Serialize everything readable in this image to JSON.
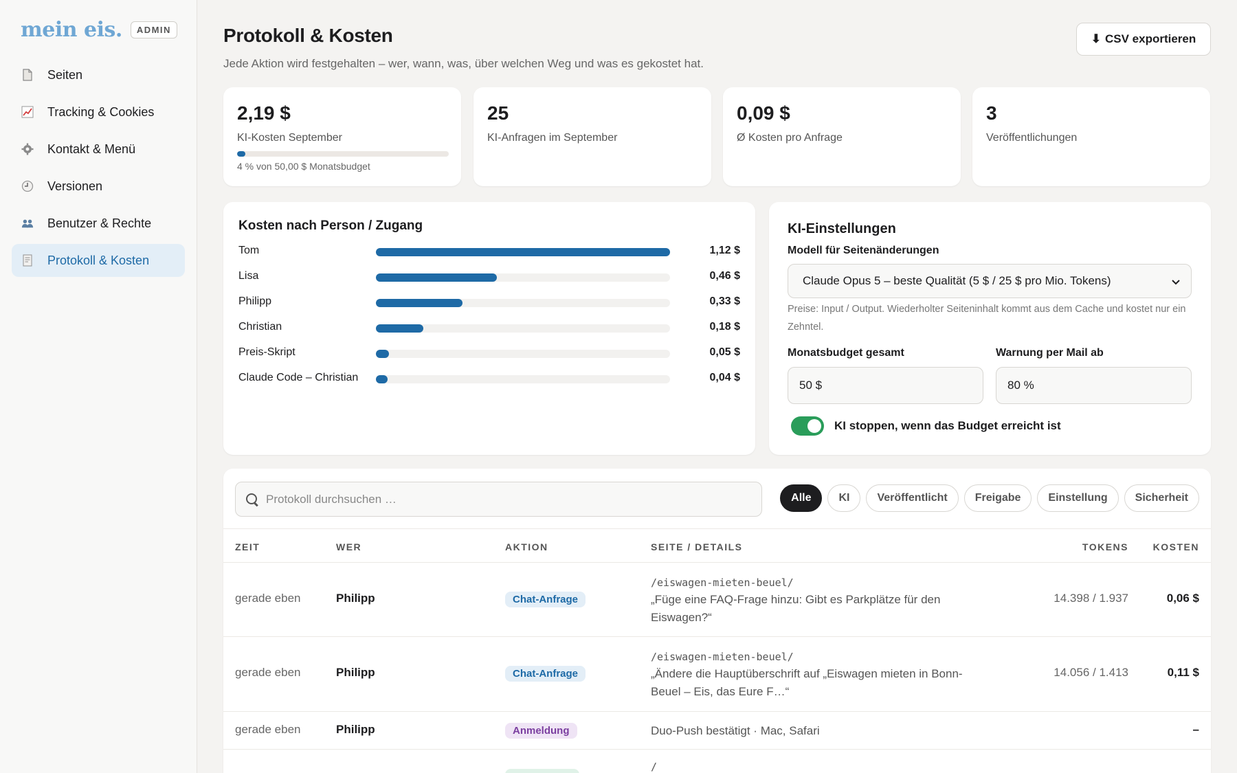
{
  "brand": {
    "logo": "mein eis.",
    "badge": "ADMIN"
  },
  "sidebar": {
    "items": [
      {
        "label": "Seiten",
        "icon": "page-icon"
      },
      {
        "label": "Tracking & Cookies",
        "icon": "chart-icon"
      },
      {
        "label": "Kontakt & Menü",
        "icon": "gear-icon"
      },
      {
        "label": "Versionen",
        "icon": "clock-icon"
      },
      {
        "label": "Benutzer & Rechte",
        "icon": "users-icon"
      },
      {
        "label": "Protokoll & Kosten",
        "icon": "receipt-icon",
        "active": true
      }
    ]
  },
  "header": {
    "title": "Protokoll & Kosten",
    "subtitle": "Jede Aktion wird festgehalten – wer, wann, was, über welchen Weg und was es gekostet hat.",
    "export_icon": "⬇",
    "export_label": "CSV exportieren"
  },
  "stats": [
    {
      "value": "2,19 $",
      "label": "KI-Kosten September",
      "budget_fraction": 0.04,
      "caption": "4 % von 50,00 $ Monatsbudget"
    },
    {
      "value": "25",
      "label": "KI-Anfragen im September"
    },
    {
      "value": "0,09 $",
      "label": "Ø Kosten pro Anfrage"
    },
    {
      "value": "3",
      "label": "Veröffentlichungen"
    }
  ],
  "costs": {
    "title": "Kosten nach Person / Zugang",
    "max": 1.12,
    "rows": [
      {
        "name": "Tom",
        "value": 1.12,
        "amount": "1,12 $"
      },
      {
        "name": "Lisa",
        "value": 0.46,
        "amount": "0,46 $"
      },
      {
        "name": "Philipp",
        "value": 0.33,
        "amount": "0,33 $"
      },
      {
        "name": "Christian",
        "value": 0.18,
        "amount": "0,18 $"
      },
      {
        "name": "Preis-Skript",
        "value": 0.05,
        "amount": "0,05 $"
      },
      {
        "name": "Claude Code – Christian",
        "value": 0.04,
        "amount": "0,04 $"
      }
    ]
  },
  "ki": {
    "title": "KI-Einstellungen",
    "model_label": "Modell für Seitenänderungen",
    "model_value": "Claude Opus 5 – beste Qualität (5 $ / 25 $ pro Mio. Tokens)",
    "hint": "Preise: Input / Output. Wiederholter Seiteninhalt kommt aus dem Cache und kostet nur ein Zehntel.",
    "budget_label": "Monatsbudget gesamt",
    "budget_value": "50 $",
    "warn_label": "Warnung per Mail ab",
    "warn_value": "80 %",
    "toggle_label": "KI stoppen, wenn das Budget erreicht ist",
    "toggle_on": true
  },
  "log": {
    "search_placeholder": "Protokoll durchsuchen …",
    "filters": [
      "Alle",
      "KI",
      "Veröffentlicht",
      "Freigabe",
      "Einstellung",
      "Sicherheit"
    ],
    "columns": [
      "ZEIT",
      "WER",
      "AKTION",
      "SEITE / DETAILS",
      "TOKENS",
      "KOSTEN"
    ],
    "rows": [
      {
        "time": "gerade eben",
        "who": "Philipp",
        "action": "Chat-Anfrage",
        "path": "/eiswagen-mieten-beuel/",
        "detail": "„Füge eine FAQ-Frage hinzu: Gibt es Parkplätze für den Eiswagen?“",
        "tokens": "14.398 / 1.937",
        "cost": "0,06 $"
      },
      {
        "time": "gerade eben",
        "who": "Philipp",
        "action": "Chat-Anfrage",
        "path": "/eiswagen-mieten-beuel/",
        "detail": "„Ändere die Hauptüberschrift auf „Eiswagen mieten in Bonn-Beuel – Eis, das Eure F…“",
        "tokens": "14.056 / 1.413",
        "cost": "0,11 $"
      },
      {
        "time": "gerade eben",
        "who": "Philipp",
        "action": "Anmeldung",
        "path": "",
        "detail": "Duo-Push bestätigt · Mac, Safari",
        "tokens": "",
        "cost": "–"
      },
      {
        "time": "",
        "who": "",
        "action": "",
        "path": "/",
        "detail": "",
        "tokens": "",
        "cost": ""
      }
    ]
  }
}
